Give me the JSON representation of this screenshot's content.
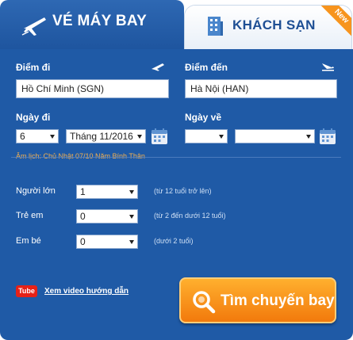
{
  "tabs": {
    "flight": {
      "label": "VÉ MÁY BAY",
      "icon": "airplane-icon"
    },
    "hotel": {
      "label": "KHÁCH SẠN",
      "icon": "building-icon",
      "badge": "New"
    }
  },
  "route": {
    "from_label": "Điểm đi",
    "from_value": "Hồ Chí Minh (SGN)",
    "to_label": "Điểm đến",
    "to_value": "Hà Nội (HAN)"
  },
  "dates": {
    "depart_label": "Ngày đi",
    "depart_day": "6",
    "depart_month": "Tháng 11/2016",
    "lunar_note": "Âm lịch: Chủ Nhật 07/10 Năm Bính Thân",
    "return_label": "Ngày về",
    "return_day": "",
    "return_month": ""
  },
  "passengers": {
    "adult_label": "Người lớn",
    "adult_value": "1",
    "adult_hint": "(từ 12 tuổi trở lên)",
    "child_label": "Trẻ em",
    "child_value": "0",
    "child_hint": "(từ 2 đến dưới 12 tuổi)",
    "infant_label": "Em bé",
    "infant_value": "0",
    "infant_hint": "(dưới 2 tuổi)"
  },
  "footer": {
    "video_badge": "Tube",
    "video_link": "Xem video hướng dẫn",
    "search_button": "Tìm chuyến bay"
  },
  "colors": {
    "panel": "#1f5aa6",
    "accent_orange": "#f27a0c",
    "tab_text": "#1e4f94"
  }
}
